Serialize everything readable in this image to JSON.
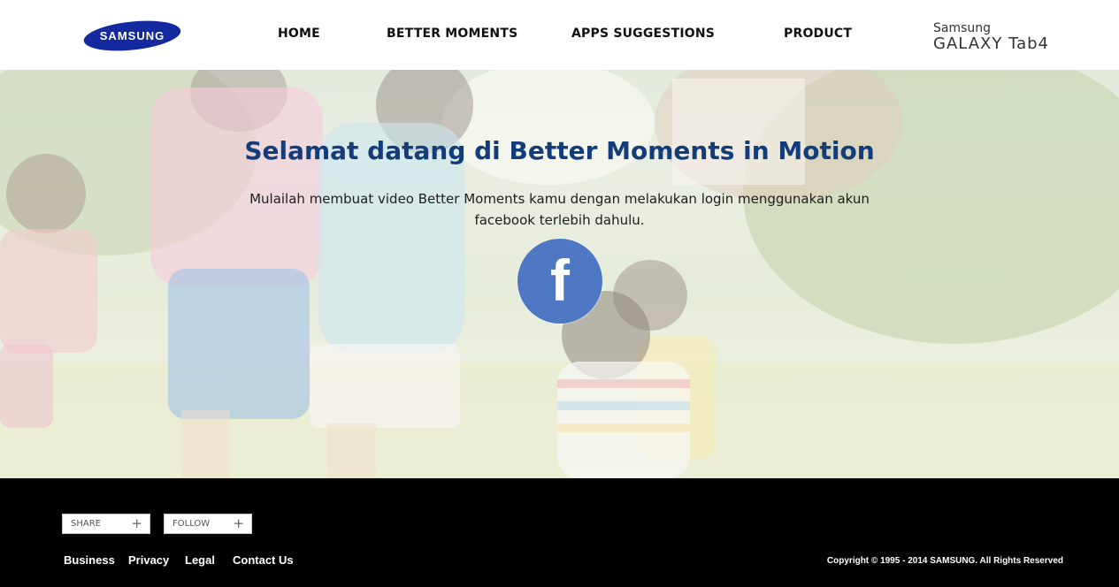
{
  "header": {
    "logo_text": "SAMSUNG",
    "nav": {
      "home": "HOME",
      "better_moments": "BETTER MOMENTS",
      "apps_suggestions": "APPS SUGGESTIONS",
      "product": "PRODUCT"
    },
    "product_logo": {
      "line1": "Samsung",
      "line2": "GALAXY Tab4"
    }
  },
  "hero": {
    "title": "Selamat datang di Better Moments in Motion",
    "text": "Mulailah membuat video Better Moments kamu dengan melakukan login menggunakan akun facebook terlebih dahulu.",
    "fb_button_glyph": "f",
    "fb_icon": "facebook-icon"
  },
  "footer": {
    "share_label": "SHARE",
    "follow_label": "FOLLOW",
    "plus": "+",
    "links": {
      "business": "Business",
      "privacy": "Privacy",
      "legal": "Legal",
      "contact": "Contact Us"
    },
    "copyright": "Copyright © 1995 - 2014 SAMSUNG. All Rights Reserved"
  },
  "colors": {
    "brand_blue": "#1428a0",
    "title_blue": "#123c7a",
    "facebook_blue": "#4f78c4",
    "footer_bg": "#000000"
  }
}
